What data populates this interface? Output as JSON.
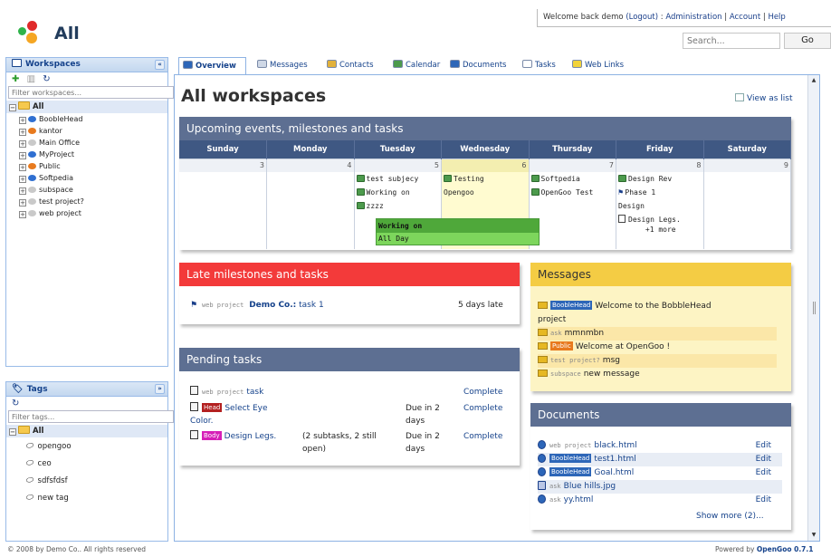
{
  "header": {
    "app_title": "All",
    "welcome_prefix": "Welcome back",
    "user": "demo",
    "logout": "(Logout)",
    "sep1": ":",
    "administration": "Administration",
    "account": "Account",
    "help": "Help",
    "search_placeholder": "Search...",
    "go_label": "Go"
  },
  "sidebar": {
    "workspaces_title": "Workspaces",
    "filter_workspaces_placeholder": "Filter workspaces...",
    "root_label": "All",
    "workspaces": [
      {
        "label": "BoobleHead",
        "color": "#2f6fd1"
      },
      {
        "label": "kantor",
        "color": "#e87a1e"
      },
      {
        "label": "Main Office",
        "color": "#c9c9c9"
      },
      {
        "label": "MyProject",
        "color": "#2f6fd1"
      },
      {
        "label": "Public",
        "color": "#e87a1e"
      },
      {
        "label": "Softpedia",
        "color": "#2f6fd1"
      },
      {
        "label": "subspace",
        "color": "#c9c9c9"
      },
      {
        "label": "test project?",
        "color": "#c9c9c9"
      },
      {
        "label": "web project",
        "color": "#c9c9c9"
      }
    ],
    "tags_title": "Tags",
    "filter_tags_placeholder": "Filter tags...",
    "tags_root_label": "All",
    "tags": [
      "opengoo",
      "ceo",
      "sdfsfdsf",
      "new tag"
    ]
  },
  "tabs": [
    {
      "label": "Overview",
      "color": "#2d66b8"
    },
    {
      "label": "Messages",
      "color": "#cfd8e6"
    },
    {
      "label": "Contacts",
      "color": "#e2b13a"
    },
    {
      "label": "Calendar",
      "color": "#4c9a4c"
    },
    {
      "label": "Documents",
      "color": "#2d66b8"
    },
    {
      "label": "Tasks",
      "color": "#ffffff"
    },
    {
      "label": "Web Links",
      "color": "#f2d33a"
    }
  ],
  "main": {
    "title": "All workspaces",
    "view_as_list": "View as list"
  },
  "calendar": {
    "title": "Upcoming events, milestones and tasks",
    "days": [
      "Sunday",
      "Monday",
      "Tuesday",
      "Wednesday",
      "Thursday",
      "Friday",
      "Saturday"
    ],
    "dates": [
      "3",
      "4",
      "5",
      "6",
      "7",
      "8",
      "9"
    ],
    "tue_events": [
      "test subjecy",
      "Working on",
      "zzzz"
    ],
    "wed_events": [
      "Testing",
      "Opengoo"
    ],
    "thu_events": [
      "Softpedia",
      "OpenGoo Test"
    ],
    "fri_events": [
      "Design Rev",
      "Phase 1",
      "Design",
      "Design Legs.",
      "+1 more"
    ],
    "tooltip_title": "Working on",
    "tooltip_body": "All Day"
  },
  "late": {
    "title": "Late milestones and tasks",
    "ws": "web project",
    "client": "Demo Co.:",
    "task": "task 1",
    "status": "5 days late"
  },
  "pending": {
    "title": "Pending tasks",
    "rows": [
      {
        "ws": "web project",
        "badge": "",
        "badge_color": "",
        "name": "task",
        "sub": "",
        "due": "",
        "due2": "",
        "action": "Complete"
      },
      {
        "ws": "",
        "badge": "Head",
        "badge_color": "#b32020",
        "name": "Select Eye",
        "name2": "Color.",
        "sub": "",
        "due": "Due in 2",
        "due2": "days",
        "action": "Complete"
      },
      {
        "ws": "",
        "badge": "Body",
        "badge_color": "#d61fb8",
        "name": "Design Legs.",
        "sub": "(2 subtasks, 2 still",
        "sub2": "open)",
        "due": "Due in 2",
        "due2": "days",
        "action": "Complete"
      }
    ]
  },
  "messages": {
    "title": "Messages",
    "rows": [
      {
        "ws": "",
        "badge": "BoobleHead",
        "badge_color": "#2d66b8",
        "text": "Welcome to the BobbleHead",
        "text2": "project"
      },
      {
        "ws": "ask",
        "badge": "",
        "badge_color": "",
        "text": "mmnmbn",
        "text2": ""
      },
      {
        "ws": "",
        "badge": "Public",
        "badge_color": "#e87a1e",
        "text": "Welcome at OpenGoo !",
        "text2": ""
      },
      {
        "ws": "test project?",
        "badge": "",
        "badge_color": "",
        "text": "msg",
        "text2": ""
      },
      {
        "ws": "subspace",
        "badge": "",
        "badge_color": "",
        "text": "new message",
        "text2": ""
      }
    ]
  },
  "documents": {
    "title": "Documents",
    "rows": [
      {
        "ws": "web project",
        "badge": "",
        "name": "black.html",
        "action": "Edit"
      },
      {
        "ws": "",
        "badge": "BoobleHead",
        "name": "test1.html",
        "action": "Edit"
      },
      {
        "ws": "",
        "badge": "BoobleHead",
        "name": "Goal.html",
        "action": "Edit"
      },
      {
        "ws": "ask",
        "badge": "",
        "name": "Blue hills.jpg",
        "action": ""
      },
      {
        "ws": "ask",
        "badge": "",
        "name": "yy.html",
        "action": "Edit"
      }
    ],
    "show_more": "Show more (2)..."
  },
  "footer": {
    "left": "© 2008 by Demo Co.. All rights reserved",
    "right_prefix": "Powered by",
    "right_brand": "OpenGoo 0.7.1"
  },
  "colors": {
    "calendar_head": "#5d6f92",
    "late_head": "#f33a3a",
    "pending_head": "#5d6f92",
    "messages_head": "#f4cc44",
    "messages_body": "#fdf4c4",
    "documents_head": "#5d6f92"
  }
}
